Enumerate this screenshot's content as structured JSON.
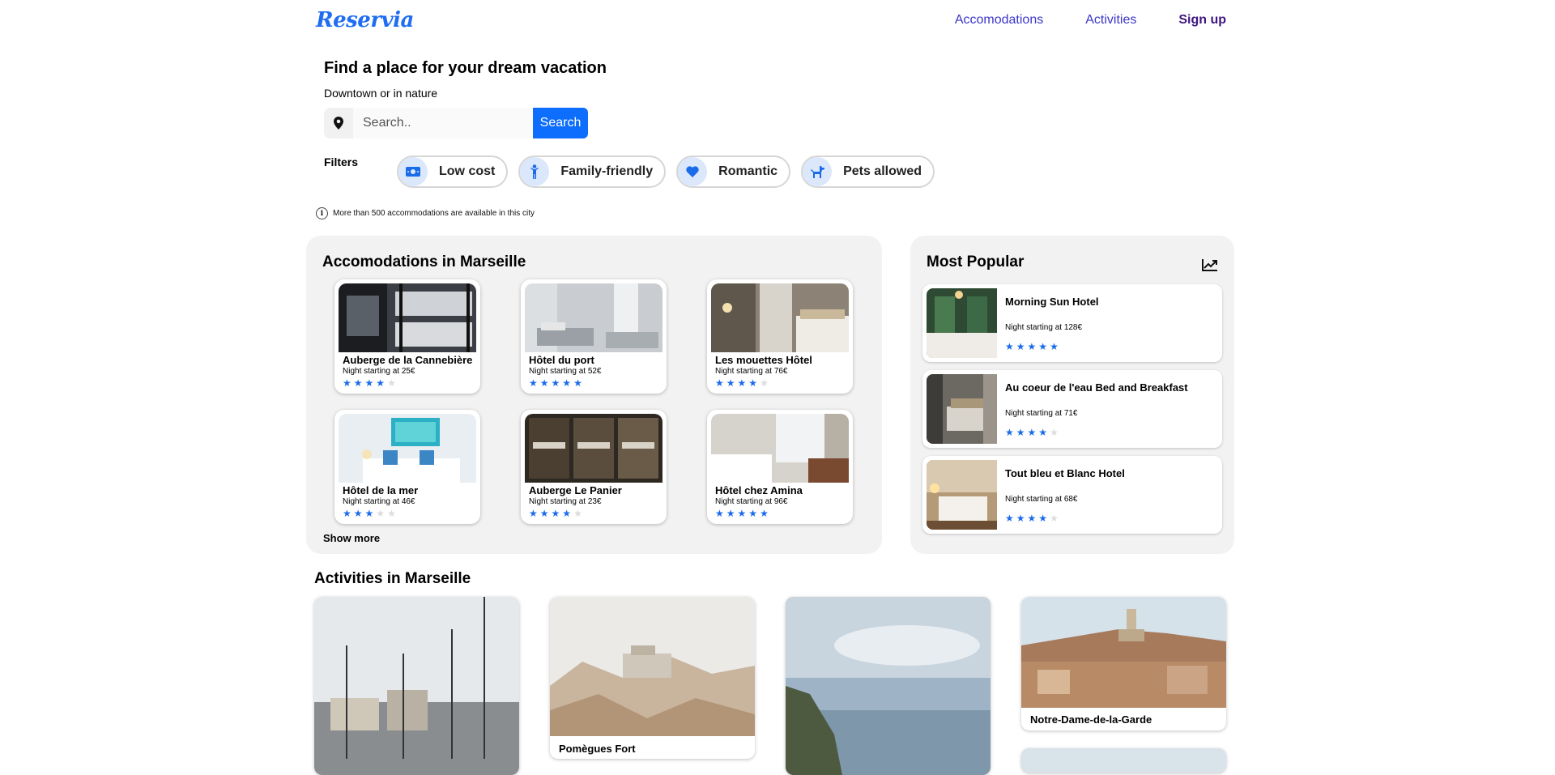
{
  "header": {
    "logo": "Reservia",
    "nav": [
      "Accomodations",
      "Activities",
      "Sign up"
    ]
  },
  "hero": {
    "title": "Find a place for your dream vacation",
    "subtitle": "Downtown or in nature",
    "search_placeholder": "Search..",
    "search_button": "Search"
  },
  "filters": {
    "label": "Filters",
    "items": [
      {
        "label": "Low cost",
        "icon": "money-icon"
      },
      {
        "label": "Family-friendly",
        "icon": "child-icon"
      },
      {
        "label": "Romantic",
        "icon": "heart-icon"
      },
      {
        "label": "Pets allowed",
        "icon": "dog-icon"
      }
    ]
  },
  "info_text": "More than 500 accommodations are available in this city",
  "accommodations": {
    "title": "Accomodations in Marseille",
    "items": [
      {
        "name": "Auberge de la Cannebière",
        "price": "Night starting at 25€",
        "rating": 4
      },
      {
        "name": "Hôtel du port",
        "price": "Night starting at 52€",
        "rating": 5
      },
      {
        "name": "Les mouettes Hôtel",
        "price": "Night starting at 76€",
        "rating": 4
      },
      {
        "name": "Hôtel de la mer",
        "price": "Night starting at 46€",
        "rating": 3
      },
      {
        "name": "Auberge Le Panier",
        "price": "Night starting at 23€",
        "rating": 4
      },
      {
        "name": "Hôtel chez Amina",
        "price": "Night starting at 96€",
        "rating": 5
      }
    ],
    "show_more": "Show more"
  },
  "popular": {
    "title": "Most Popular",
    "items": [
      {
        "name": "Morning Sun Hotel",
        "price": "Night starting at 128€",
        "rating": 5
      },
      {
        "name": "Au coeur de l'eau Bed and Breakfast",
        "price": "Night starting at 71€",
        "rating": 4
      },
      {
        "name": "Tout bleu et Blanc Hotel",
        "price": "Night starting at 68€",
        "rating": 4
      }
    ]
  },
  "activities": {
    "title": "Activities in Marseille",
    "items": [
      {
        "label": ""
      },
      {
        "label": "Pomègues Fort"
      },
      {
        "label": ""
      },
      {
        "label": "Notre-Dame-de-la-Garde"
      }
    ]
  },
  "colors": {
    "accent": "#0d6dfd",
    "star": "#1a6bea",
    "nav_link": "#3a36c8",
    "panel_bg": "#f2f2f2"
  }
}
